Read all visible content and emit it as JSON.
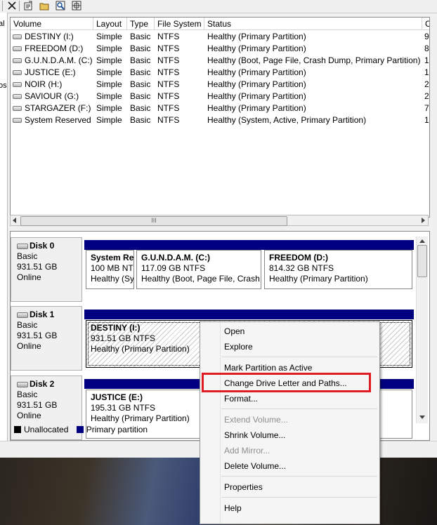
{
  "toolbar": {
    "icons": [
      "close-icon",
      "properties-icon",
      "open-folder-icon",
      "search-icon",
      "help-icon"
    ]
  },
  "left_strip": {
    "labels": [
      "al",
      "os"
    ]
  },
  "volume_list": {
    "columns": [
      "Volume",
      "Layout",
      "Type",
      "File System",
      "Status",
      "C"
    ],
    "rows": [
      {
        "volume": "DESTINY (I:)",
        "layout": "Simple",
        "type": "Basic",
        "fs": "NTFS",
        "status": "Healthy (Primary Partition)",
        "cap": "9"
      },
      {
        "volume": "FREEDOM (D:)",
        "layout": "Simple",
        "type": "Basic",
        "fs": "NTFS",
        "status": "Healthy (Primary Partition)",
        "cap": "8"
      },
      {
        "volume": "G.U.N.D.A.M. (C:)",
        "layout": "Simple",
        "type": "Basic",
        "fs": "NTFS",
        "status": "Healthy (Boot, Page File, Crash Dump, Primary Partition)",
        "cap": "1"
      },
      {
        "volume": "JUSTICE (E:)",
        "layout": "Simple",
        "type": "Basic",
        "fs": "NTFS",
        "status": "Healthy (Primary Partition)",
        "cap": "1"
      },
      {
        "volume": "NOIR (H:)",
        "layout": "Simple",
        "type": "Basic",
        "fs": "NTFS",
        "status": "Healthy (Primary Partition)",
        "cap": "2"
      },
      {
        "volume": "SAVIOUR (G:)",
        "layout": "Simple",
        "type": "Basic",
        "fs": "NTFS",
        "status": "Healthy (Primary Partition)",
        "cap": "2"
      },
      {
        "volume": "STARGAZER (F:)",
        "layout": "Simple",
        "type": "Basic",
        "fs": "NTFS",
        "status": "Healthy (Primary Partition)",
        "cap": "7"
      },
      {
        "volume": "System Reserved",
        "layout": "Simple",
        "type": "Basic",
        "fs": "NTFS",
        "status": "Healthy (System, Active, Primary Partition)",
        "cap": "1"
      }
    ],
    "scroll_grip": "III"
  },
  "disks": [
    {
      "name": "Disk 0",
      "type": "Basic",
      "size": "931.51 GB",
      "state": "Online",
      "partitions": [
        {
          "title": "System Re",
          "size": "100 MB NTF",
          "status": "Healthy (Sy"
        },
        {
          "title": "G.U.N.D.A.M.  (C:)",
          "size": "117.09 GB NTFS",
          "status": "Healthy (Boot, Page File, Crash I"
        },
        {
          "title": "FREEDOM  (D:)",
          "size": "814.32 GB NTFS",
          "status": "Healthy (Primary Partition)"
        }
      ]
    },
    {
      "name": "Disk 1",
      "type": "Basic",
      "size": "931.51 GB",
      "state": "Online",
      "partitions": [
        {
          "title": "DESTINY  (I:)",
          "size": "931.51 GB NTFS",
          "status": "Healthy (Primary Partition)"
        }
      ]
    },
    {
      "name": "Disk 2",
      "type": "Basic",
      "size": "931.51 GB",
      "state": "Online",
      "partitions": [
        {
          "title": "JUSTICE  (E:)",
          "size": "195.31 GB NTFS",
          "status": "Healthy (Primary Partition)"
        }
      ]
    }
  ],
  "legend": [
    {
      "label": "Unallocated",
      "color": "#000000"
    },
    {
      "label": "Primary partition",
      "color": "#000080"
    }
  ],
  "context_menu": {
    "items": [
      {
        "label": "Open",
        "enabled": true
      },
      {
        "label": "Explore",
        "enabled": true
      },
      {
        "label": "Mark Partition as Active",
        "enabled": true
      },
      {
        "label": "Change Drive Letter and Paths...",
        "enabled": true,
        "highlighted": true
      },
      {
        "label": "Format...",
        "enabled": true
      },
      {
        "label": "Extend Volume...",
        "enabled": false
      },
      {
        "label": "Shrink Volume...",
        "enabled": true
      },
      {
        "label": "Add Mirror...",
        "enabled": false
      },
      {
        "label": "Delete Volume...",
        "enabled": true
      },
      {
        "label": "Properties",
        "enabled": true
      },
      {
        "label": "Help",
        "enabled": true
      }
    ]
  },
  "colors": {
    "partition_bar": "#000080",
    "highlight_box": "#e01b22"
  }
}
